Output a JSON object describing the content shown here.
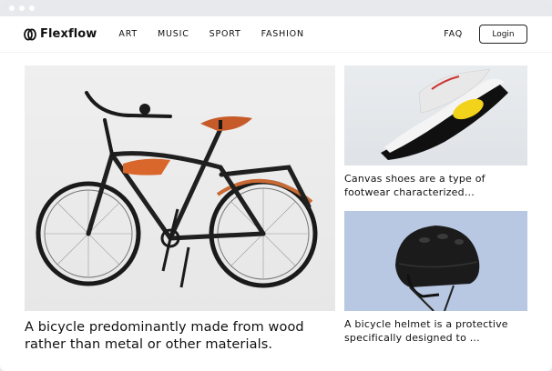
{
  "brand": {
    "name": "Flexflow"
  },
  "nav": {
    "items": [
      "ART",
      "MUSIC",
      "SPORT",
      "FASHION"
    ],
    "faq": "FAQ",
    "login": "Login"
  },
  "articles": {
    "main": {
      "title": "A bicycle predominantly made from wood rather than metal or other materials."
    },
    "side": [
      {
        "title": "Canvas shoes are a type of footwear characterized..."
      },
      {
        "title": "A bicycle helmet is a protective specifically designed to ..."
      }
    ]
  },
  "colors": {
    "text": "#111111",
    "browser_bar": "#e8e9ed",
    "helmet_bg": "#b8c8e2",
    "bike_accent": "#d9662a"
  }
}
